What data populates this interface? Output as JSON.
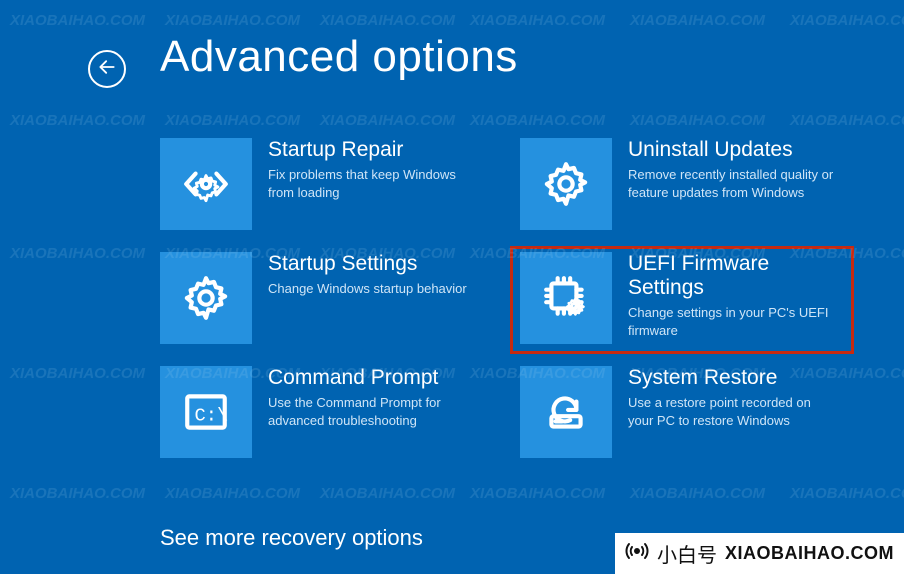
{
  "title": "Advanced options",
  "more_link": "See more recovery options",
  "highlighted_tile_index": 3,
  "tiles": [
    {
      "id": "startup-repair",
      "title": "Startup Repair",
      "desc": "Fix problems that keep Windows from loading",
      "icon": "code-gear-icon"
    },
    {
      "id": "uninstall-updates",
      "title": "Uninstall Updates",
      "desc": "Remove recently installed quality or feature updates from Windows",
      "icon": "gear-icon"
    },
    {
      "id": "startup-settings",
      "title": "Startup Settings",
      "desc": "Change Windows startup behavior",
      "icon": "gear-icon"
    },
    {
      "id": "uefi-firmware",
      "title": "UEFI Firmware Settings",
      "desc": "Change settings in your PC's UEFI firmware",
      "icon": "chip-gear-icon"
    },
    {
      "id": "command-prompt",
      "title": "Command Prompt",
      "desc": "Use the Command Prompt for advanced troubleshooting",
      "icon": "terminal-icon"
    },
    {
      "id": "system-restore",
      "title": "System Restore",
      "desc": "Use a restore point recorded on your PC to restore Windows",
      "icon": "restore-icon"
    }
  ],
  "watermark_text": "XIAOBAIHAO.COM",
  "badge": {
    "cn": "小白号",
    "en": "XIAOBAIHAO.COM"
  }
}
